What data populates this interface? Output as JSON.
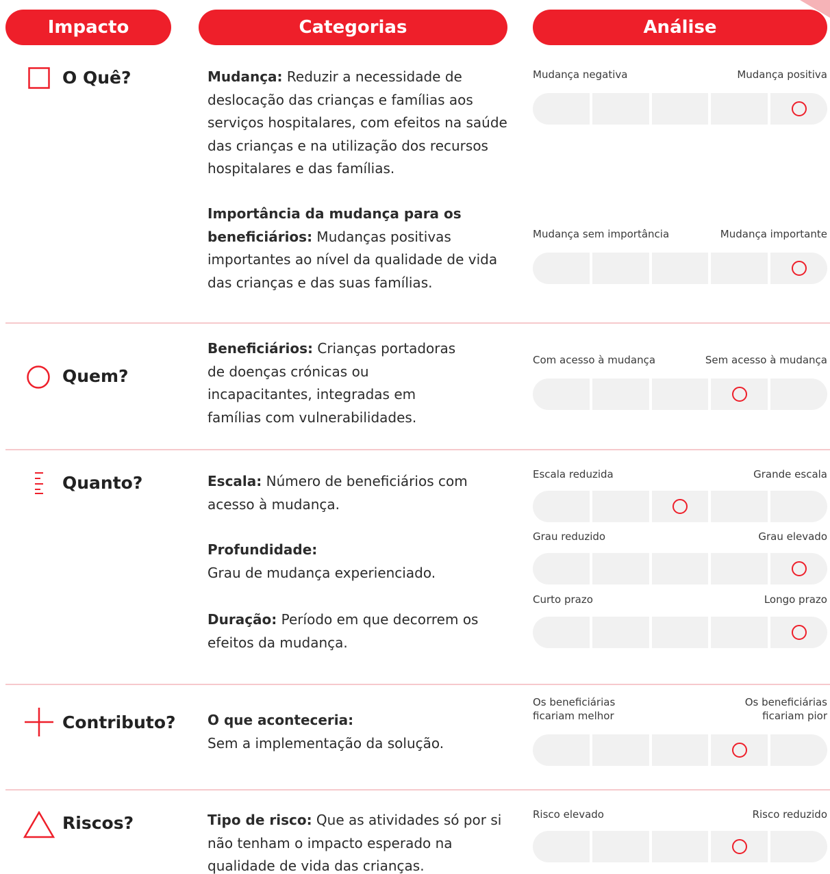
{
  "headers": {
    "impacto": "Impacto",
    "categorias": "Categorias",
    "analise": "Análise"
  },
  "accent_color": "#ee1f2a",
  "rows": [
    {
      "label": "O Quê?",
      "icon": "square-icon",
      "categories": [
        {
          "term": "Mudança:",
          "text": " Reduzir a necessidade de deslocação das crianças e famílias aos serviços hospitalares, com efeitos na saúde das crianças e na utilização dos recursos hospitalares e das famílias."
        },
        {
          "term": "Importância da mudança para os beneficiários:",
          "text": " Mudanças positivas importantes ao nível da qualidade de vida das crianças e das suas famílias."
        }
      ],
      "scales": [
        {
          "left": "Mudança negativa",
          "right": "Mudança positiva",
          "selected": 5
        },
        {
          "left": "Mudança sem importância",
          "right": "Mudança importante",
          "selected": 5
        }
      ]
    },
    {
      "label": "Quem?",
      "icon": "circle-icon",
      "categories": [
        {
          "term": "Beneficiários:",
          "text": " Crianças portadoras de doenças crónicas ou incapacitantes, integradas em famílias com vulnerabilidades."
        }
      ],
      "scales": [
        {
          "left": "Com acesso à mudança",
          "right": "Sem acesso à mudança",
          "selected": 4
        }
      ]
    },
    {
      "label": "Quanto?",
      "icon": "ruler-icon",
      "categories": [
        {
          "term": "Escala:",
          "text": " Número de beneficiários com acesso à mudança."
        },
        {
          "term": "Profundidade:",
          "text": "Grau de mudança experienciado."
        },
        {
          "term": "Duração:",
          "text": " Período em que decorrem os efeitos da mudança."
        }
      ],
      "scales": [
        {
          "left": "Escala reduzida",
          "right": "Grande escala",
          "selected": 3
        },
        {
          "left": "Grau reduzido",
          "right": "Grau elevado",
          "selected": 5
        },
        {
          "left": "Curto prazo",
          "right": "Longo prazo",
          "selected": 5
        }
      ]
    },
    {
      "label": "Contributo?",
      "icon": "plus-icon",
      "categories": [
        {
          "term": "O que aconteceria:",
          "text": "Sem a implementação da solução."
        }
      ],
      "scales": [
        {
          "left_line1": "Os beneficiárias",
          "left_line2": "ficariam melhor",
          "right_line1": "Os beneficiárias",
          "right_line2": "ficariam pior",
          "selected": 4
        }
      ]
    },
    {
      "label": "Riscos?",
      "icon": "triangle-icon",
      "categories": [
        {
          "term": "Tipo de risco:",
          "text": " Que as atividades só por si não tenham o impacto esperado na qualidade de vida das crianças."
        }
      ],
      "scales": [
        {
          "left": "Risco elevado",
          "right": "Risco reduzido",
          "selected": 4
        }
      ]
    }
  ]
}
